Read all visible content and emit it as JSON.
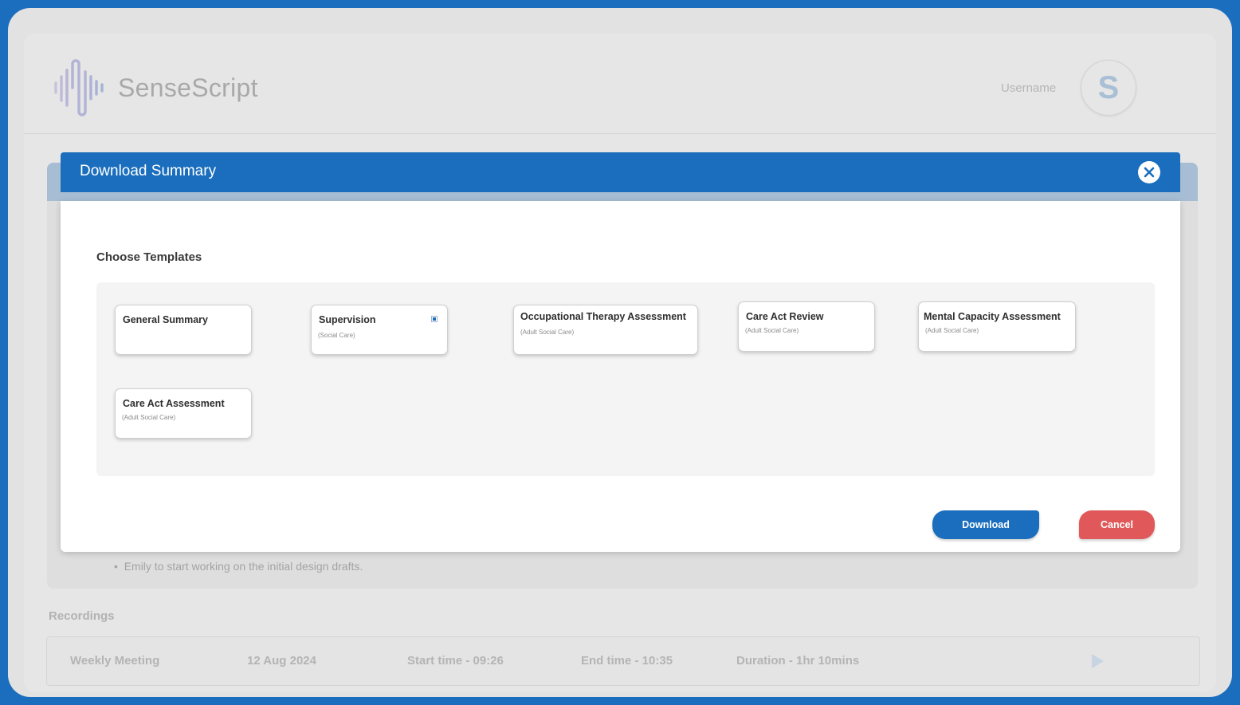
{
  "app": {
    "name": "SenseScript",
    "username": "Username",
    "avatar_initial": "S"
  },
  "background": {
    "bullet": "Emily to start working on the initial design drafts.",
    "recordings_label": "Recordings",
    "recording": {
      "title": "Weekly Meeting",
      "date": "12 Aug 2024",
      "start": "Start time - 09:26",
      "end": "End time - 10:35",
      "duration": "Duration - 1hr 10mins"
    }
  },
  "modal": {
    "title": "Download Summary",
    "section_label": "Choose Templates",
    "templates": [
      {
        "name": "General Summary",
        "sub": "",
        "selected": false
      },
      {
        "name": "Supervision",
        "sub": "(Social Care)",
        "selected": true
      },
      {
        "name": "Occupational Therapy Assessment",
        "sub": "(Adult Social Care)",
        "selected": false
      },
      {
        "name": "Care Act Review",
        "sub": "(Adult Social Care)",
        "selected": false
      },
      {
        "name": "Mental Capacity Assessment",
        "sub": "(Adult Social Care)",
        "selected": false
      },
      {
        "name": "Care Act Assessment",
        "sub": "(Adult Social Care)",
        "selected": false
      }
    ],
    "download_label": "Download",
    "cancel_label": "Cancel"
  },
  "colors": {
    "primary": "#1a6ebd",
    "cancel": "#e0585a"
  }
}
